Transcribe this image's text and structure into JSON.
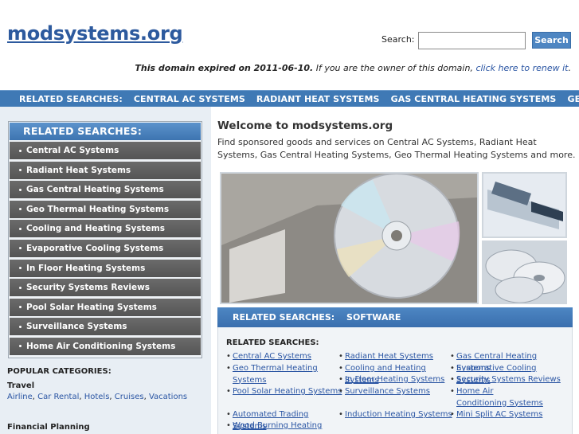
{
  "header": {
    "logo": "modsystems.org",
    "search_label": "Search:",
    "search_value": "",
    "search_button": "Search",
    "expired_bold": "This domain expired on 2011-06-10.",
    "expired_text": " If you are the owner of this domain, ",
    "renew_link": "click here to renew it",
    "expired_end": "."
  },
  "topnav": [
    "RELATED SEARCHES:",
    "CENTRAL AC SYSTEMS",
    "RADIANT HEAT SYSTEMS",
    "GAS CENTRAL HEATING SYSTEMS",
    "GEO"
  ],
  "sidebar": {
    "title": "RELATED SEARCHES:",
    "items": [
      "Central AC Systems",
      "Radiant Heat Systems",
      "Gas Central Heating Systems",
      "Geo Thermal Heating Systems",
      "Cooling and Heating Systems",
      "Evaporative Cooling Systems",
      "In Floor Heating Systems",
      "Security Systems Reviews",
      "Pool Solar Heating Systems",
      "Surveillance Systems",
      "Home Air Conditioning Systems"
    ],
    "popular_title": "POPULAR CATEGORIES:",
    "categories": [
      {
        "title": "Travel",
        "links": [
          "Airline",
          "Car Rental",
          "Hotels",
          "Cruises",
          "Vacations"
        ]
      },
      {
        "title": "Financial Planning",
        "links": []
      }
    ]
  },
  "main": {
    "welcome": "Welcome to modsystems.org",
    "description": "Find sponsored goods and services on Central AC Systems, Radiant Heat Systems, Gas Central Heating Systems, Geo Thermal Heating Systems and more.",
    "rel_bar": [
      "RELATED SEARCHES:",
      "SOFTWARE"
    ],
    "panel_title": "RELATED SEARCHES:",
    "links": [
      "Central AC Systems",
      "Radiant Heat Systems",
      "Gas Central Heating Systems",
      "Geo Thermal Heating Systems",
      "Cooling and Heating Systems",
      "Evaporative Cooling Systems",
      "Pool Solar Heating Systems",
      "In Floor Heating Systems",
      "Security Systems Reviews",
      "Surveillance Systems",
      "Home Air Conditioning Systems",
      "Automated Trading Systems",
      "Induction Heating Systems",
      "Mini Split AC Systems",
      "Wood Burning Heating"
    ]
  },
  "colors": {
    "accent": "#3f79b5",
    "link": "#2a55a3",
    "sidebar_item": "#5e5e5e"
  }
}
